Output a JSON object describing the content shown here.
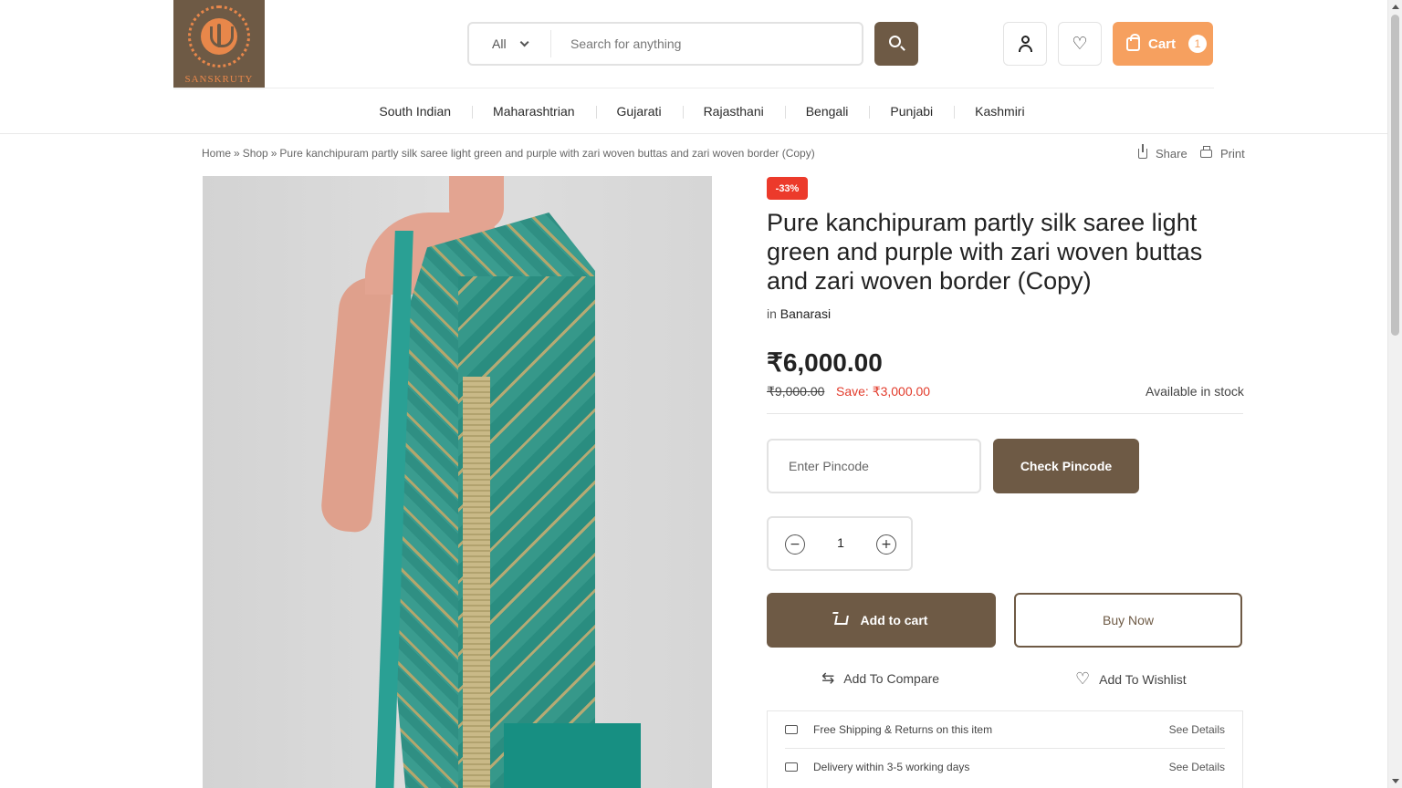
{
  "brand": {
    "name": "SANSKRUTY"
  },
  "search": {
    "category": "All",
    "placeholder": "Search for anything"
  },
  "cart": {
    "label": "Cart",
    "count": "1"
  },
  "nav": [
    "South Indian",
    "Maharashtrian",
    "Gujarati",
    "Rajasthani",
    "Bengali",
    "Punjabi",
    "Kashmiri"
  ],
  "breadcrumb": {
    "home": "Home",
    "shop": "Shop",
    "current": "Pure kanchipuram partly silk saree light green and purple with zari woven buttas and zari woven border (Copy)",
    "separator": "»"
  },
  "actions": {
    "share": "Share",
    "print": "Print"
  },
  "product": {
    "discount_badge": "-33%",
    "title": "Pure kanchipuram partly silk saree light green and purple with zari woven buttas and zari woven border (Copy)",
    "in_label": "in",
    "category": "Banarasi",
    "price": "₹6,000.00",
    "old_price": "₹9,000.00",
    "save": "Save: ₹3,000.00",
    "stock": "Available in stock"
  },
  "pincode": {
    "placeholder": "Enter Pincode",
    "button": "Check Pincode"
  },
  "quantity": {
    "value": "1",
    "minus": "−",
    "plus": "+"
  },
  "buttons": {
    "add_to_cart": "Add to cart",
    "buy_now": "Buy Now",
    "compare": "Add To Compare",
    "wishlist": "Add To Wishlist"
  },
  "features": [
    {
      "text": "Free Shipping & Returns on this item",
      "link": "See Details"
    },
    {
      "text": "Delivery within 3-5 working days",
      "link": "See Details"
    }
  ],
  "colors": {
    "primary": "#6e5a45",
    "accent": "#f6a05f",
    "sale": "#ec3a2b"
  }
}
